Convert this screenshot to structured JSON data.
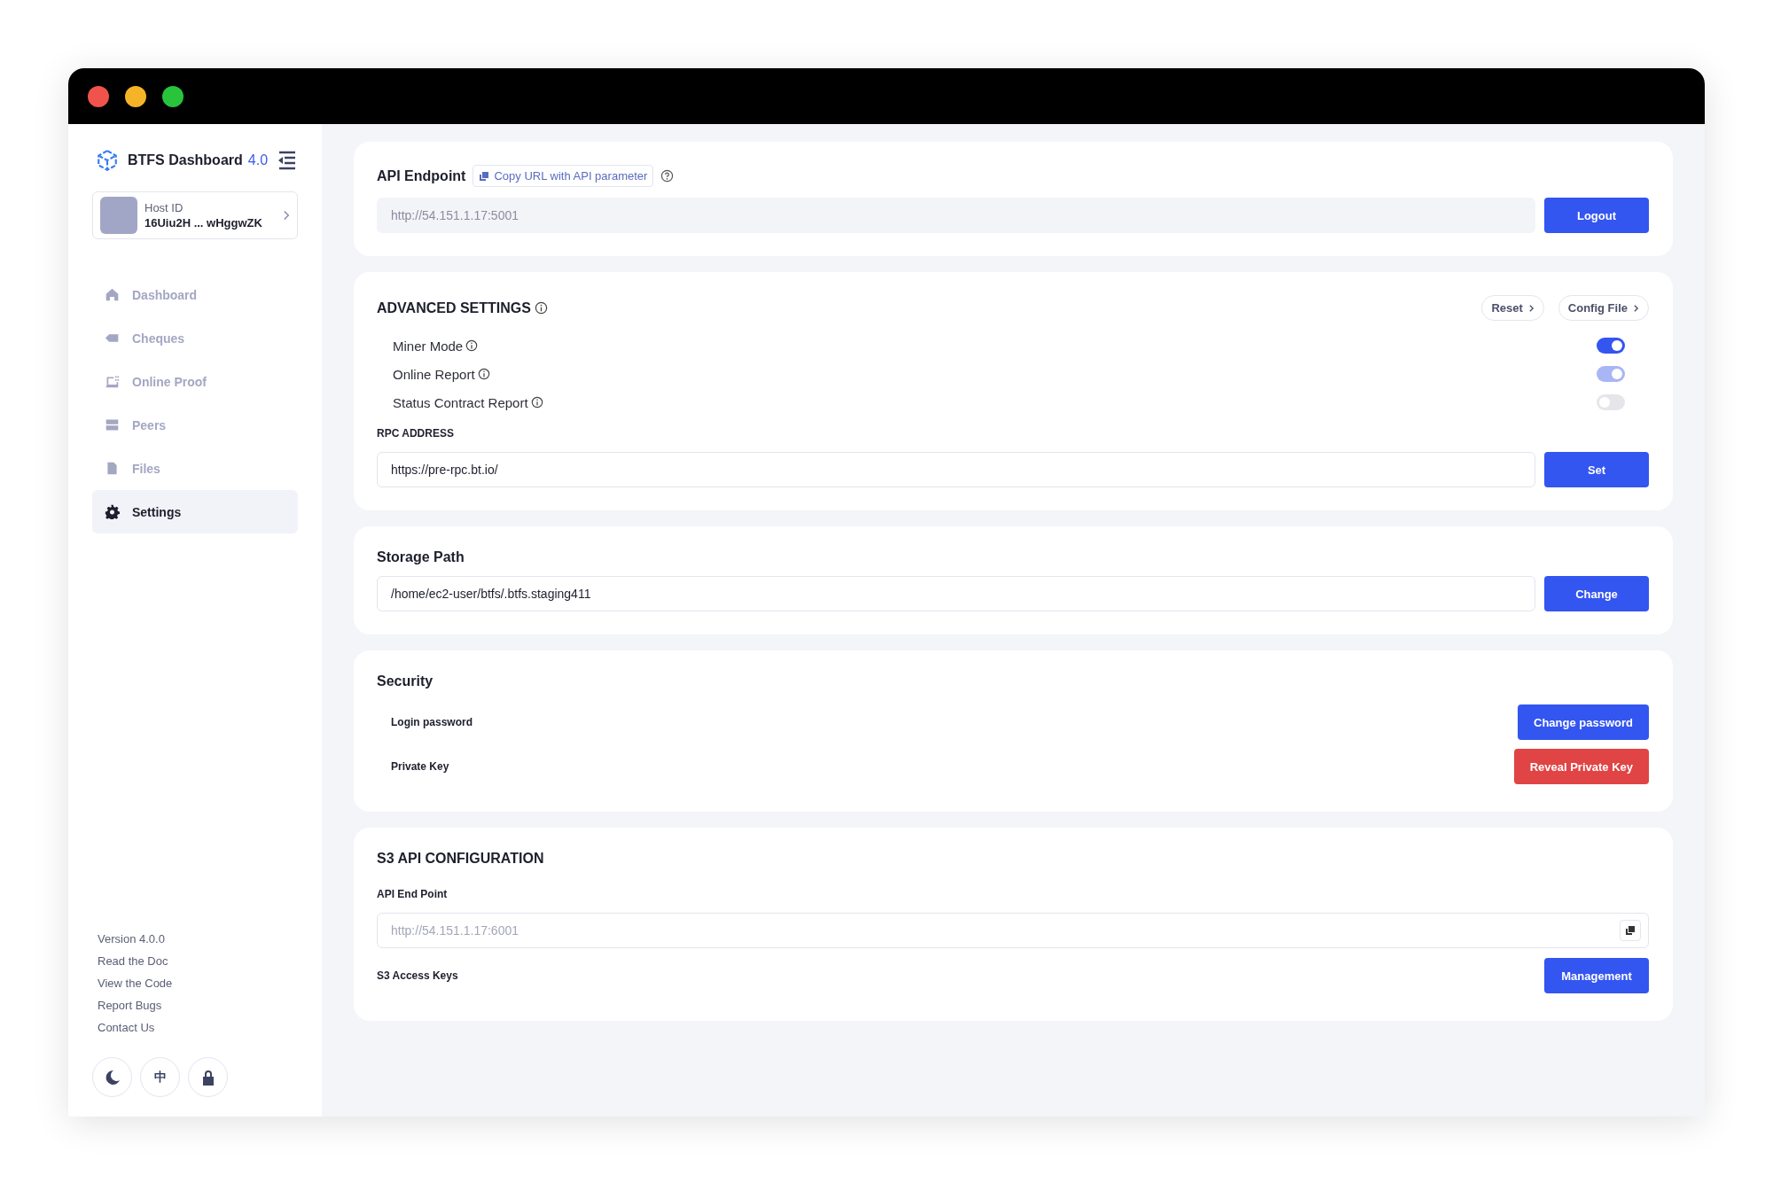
{
  "sidebar": {
    "brand": {
      "name": "BTFS Dashboard",
      "version": "4.0"
    },
    "host": {
      "label": "Host ID",
      "value": "16Uiu2H ... wHggwZK"
    },
    "items": [
      {
        "label": "Dashboard",
        "selected": false
      },
      {
        "label": "Cheques",
        "selected": false
      },
      {
        "label": "Online Proof",
        "selected": false
      },
      {
        "label": "Peers",
        "selected": false
      },
      {
        "label": "Files",
        "selected": false
      },
      {
        "label": "Settings",
        "selected": true
      }
    ],
    "links": [
      "Version 4.0.0",
      "Read the Doc",
      "View the Code",
      "Report Bugs",
      "Contact Us"
    ],
    "language_button": "中"
  },
  "api_endpoint": {
    "title": "API Endpoint",
    "copy_button": "Copy URL with API parameter",
    "value": "http://54.151.1.17:5001",
    "button": "Logout"
  },
  "advanced": {
    "title": "ADVANCED SETTINGS",
    "buttons": [
      "Reset",
      "Config File"
    ],
    "toggles": [
      {
        "label": "Miner Mode",
        "on": true,
        "disabled": false
      },
      {
        "label": "Online Report",
        "on": true,
        "disabled": true
      },
      {
        "label": "Status Contract Report",
        "on": false,
        "disabled": false
      }
    ],
    "rpc_label": "RPC ADDRESS",
    "rpc_value": "https://pre-rpc.bt.io/",
    "rpc_button": "Set"
  },
  "storage": {
    "title": "Storage Path",
    "value": "/home/ec2-user/btfs/.btfs.staging411",
    "button": "Change"
  },
  "security": {
    "title": "Security",
    "rows": [
      {
        "label": "Login password",
        "button": "Change password",
        "kind": "primary"
      },
      {
        "label": "Private Key",
        "button": "Reveal Private Key",
        "kind": "danger"
      }
    ]
  },
  "s3": {
    "title": "S3 API CONFIGURATION",
    "endpoint_label": "API End Point",
    "endpoint_placeholder": "http://54.151.1.17:6001",
    "keys_label": "S3 Access Keys",
    "keys_button": "Management"
  }
}
